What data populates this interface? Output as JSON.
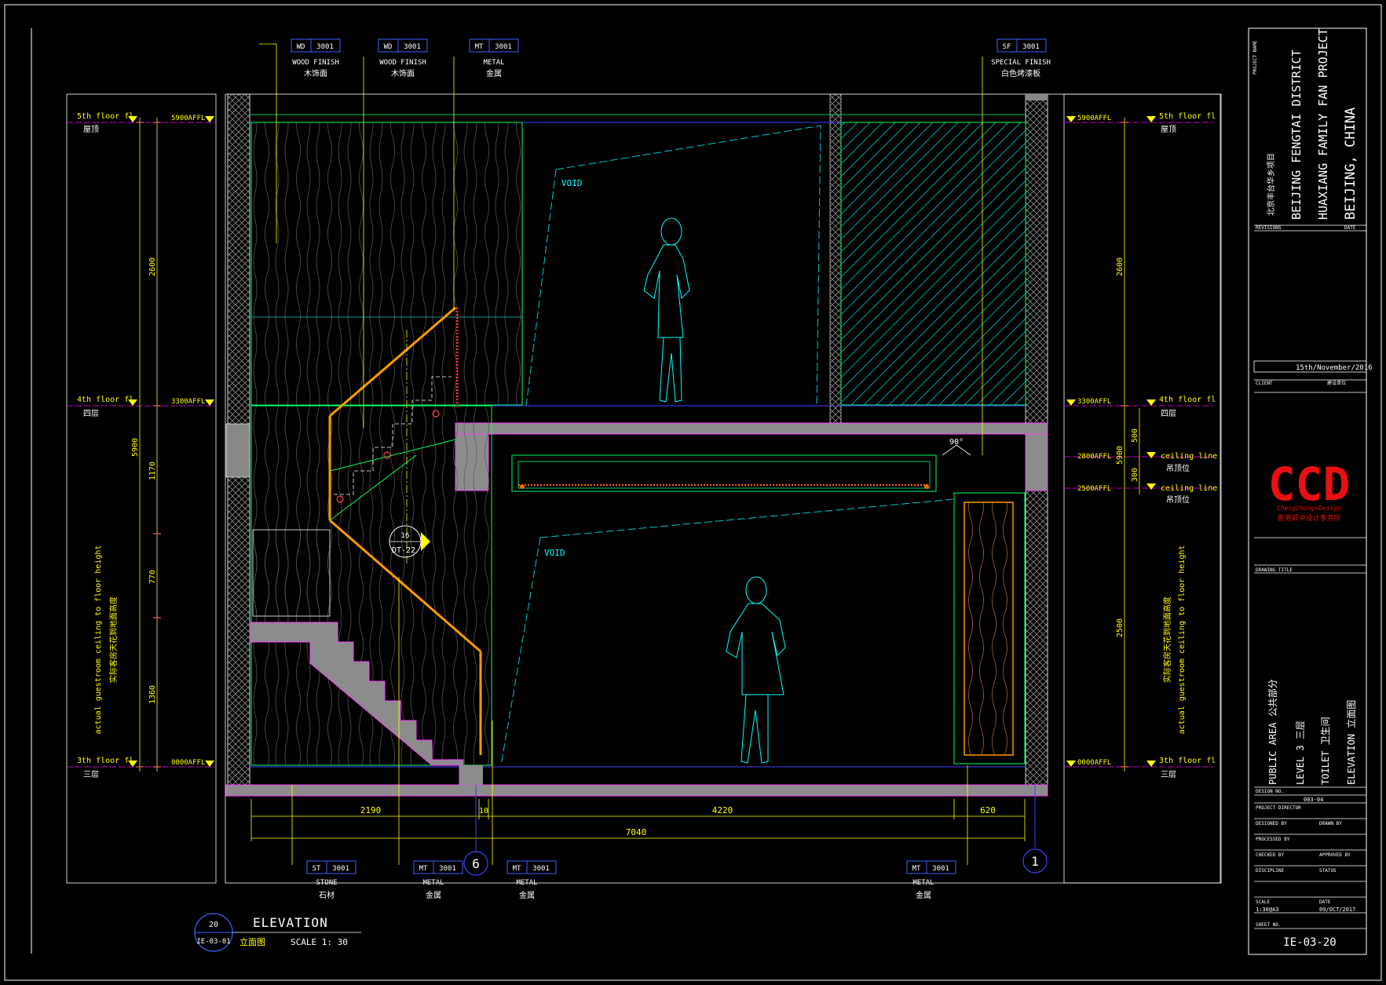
{
  "sheet": {
    "title": "ELEVATION",
    "title_cn": "立面图",
    "scale": "SCALE  1:  30",
    "view_number": "20",
    "view_ref": "IE-03-01",
    "drawing_no": "IE-03-20"
  },
  "levels": [
    {
      "en": "5th floor fl",
      "cn": "屋顶",
      "val": "5900AFFL"
    },
    {
      "en": "4th floor fl",
      "cn": "四层",
      "val": "3300AFFL"
    },
    {
      "en": "3th floor fl",
      "cn": "三层",
      "val": "0000AFFL"
    }
  ],
  "ceiling_levels": [
    {
      "en": "ceiling line",
      "cn": "吊顶位",
      "val": "2800AFFL"
    },
    {
      "en": "ceiling line",
      "cn": "吊顶位",
      "val": "2500AFFL"
    }
  ],
  "left_dims": [
    "2600",
    "5900",
    "1170",
    "770",
    "1360"
  ],
  "right_dims": [
    "2600",
    "500",
    "300",
    "5900",
    "2500"
  ],
  "height_note": {
    "en": "actual guestroom ceiling to floor height",
    "cn": "实际客房天花到地面高度"
  },
  "top_tags": [
    {
      "code": "WD",
      "num": "3001",
      "en": "WOOD FINISH",
      "cn": "木饰面"
    },
    {
      "code": "WD",
      "num": "3001",
      "en": "WOOD FINISH",
      "cn": "木饰面"
    },
    {
      "code": "MT",
      "num": "3001",
      "en": "METAL",
      "cn": "金属"
    },
    {
      "code": "SF",
      "num": "3001",
      "en": "SPECIAL FINISH",
      "cn": "白色烤漆板"
    }
  ],
  "bottom_tags": [
    {
      "code": "ST",
      "num": "3001",
      "en": "STONE",
      "cn": "石材"
    },
    {
      "code": "MT",
      "num": "3001",
      "en": "METAL",
      "cn": "金属"
    },
    {
      "code": "MT",
      "num": "3001",
      "en": "METAL",
      "cn": "金属"
    },
    {
      "code": "MT",
      "num": "3001",
      "en": "METAL",
      "cn": "金属"
    }
  ],
  "bottom_dims": {
    "d1": "2190",
    "d2": "10",
    "d3": "4220",
    "d4": "620",
    "total": "7040"
  },
  "grid": {
    "a": "6",
    "b": "1"
  },
  "annotations": {
    "void": "VOID",
    "angle": "90°",
    "detail_top": "16",
    "detail_bottom": "DT-22"
  },
  "title_block": {
    "project_label": "PROJECT NAME",
    "project_cn": "北京丰台华乡项目",
    "project_en1": "BEIJING FENGTAI DISTRICT",
    "project_en2": "HUAXIANG FAMILY FAN PROJECT",
    "project_en3": "BEIJING, CHINA",
    "revisions": "REVISIONS",
    "date": "DATE",
    "rev_date": "15th/November/2016",
    "client": "CLIENT",
    "client_cn": "建设单位",
    "logo": "CCD",
    "logo_sub": "ChengChung+Design",
    "logo_cn": "香港郑中设计事务所",
    "area": "PUBLIC AREA  公共部分",
    "level": "LEVEL 3  三层",
    "room": "TOILET  卫生间",
    "view": "ELEVATION  立面图",
    "design_no_label": "DESIGN NO.",
    "design_no": "003-04",
    "drawing_title_label": "DRAWING TITLE",
    "project_director": "PROJECT DIRECTOR",
    "designed_by": "DESIGNED BY",
    "drawn_by": "DRAWN BY",
    "processed_by": "PROCESSED BY",
    "checked_by": "CHECKED BY",
    "approved_by": "APPROVED BY",
    "discipline": "DISCIPLINE",
    "status": "STATUS",
    "scale_label": "SCALE",
    "scale_val": "1:30@A3",
    "date_label": "DATE",
    "date_val": "09/OCT/2017",
    "sheet_no": "SHEET NO."
  }
}
